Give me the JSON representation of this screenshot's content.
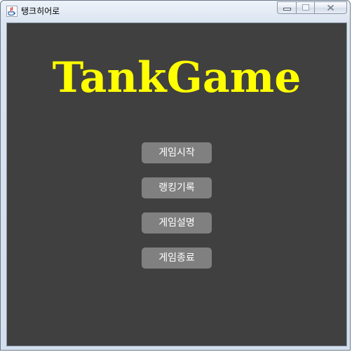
{
  "window": {
    "title": "탱크히어로",
    "app_icon": "java-icon",
    "controls": [
      "minimize-icon",
      "maximize-icon",
      "close-icon"
    ]
  },
  "game": {
    "title": "TankGame",
    "title_color": "#ffff00",
    "background_color": "#404040"
  },
  "menu": {
    "items": [
      {
        "label": "게임시작"
      },
      {
        "label": "랭킹기록"
      },
      {
        "label": "게임설명"
      },
      {
        "label": "게임종료"
      }
    ],
    "button_color": "#808080",
    "text_color": "#ffffff"
  }
}
